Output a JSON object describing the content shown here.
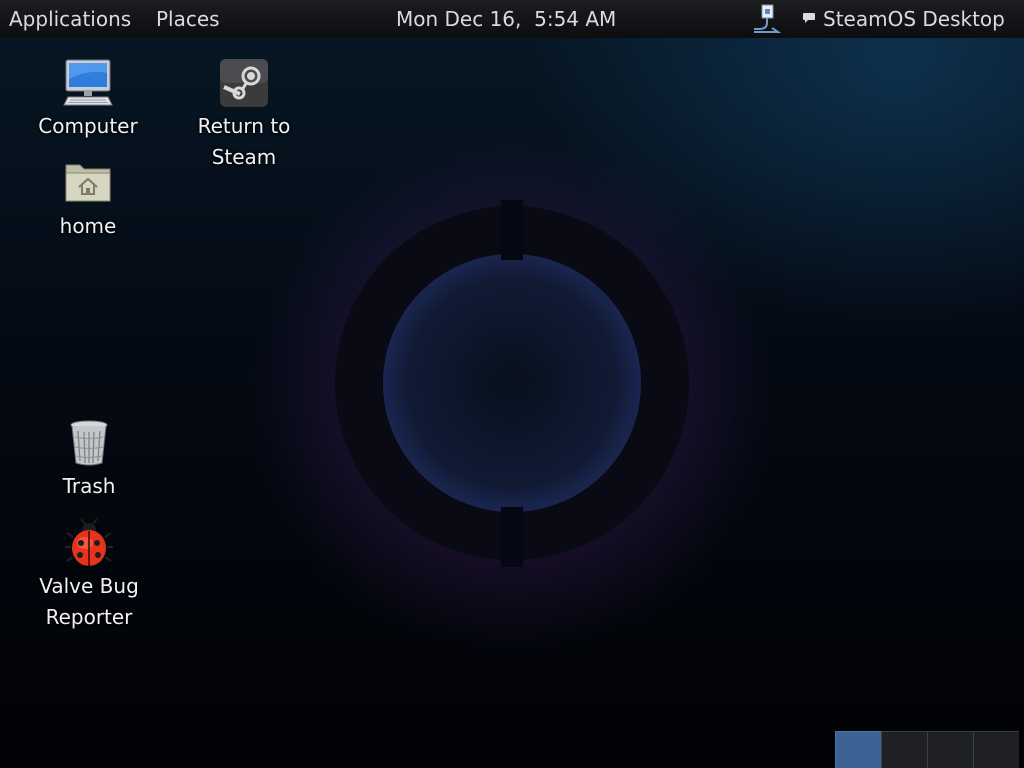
{
  "top_panel": {
    "applications_label": "Applications",
    "places_label": "Places",
    "clock": {
      "date": "Mon Dec 16,",
      "time": "5:54 AM"
    },
    "session_label": "SteamOS Desktop"
  },
  "desktop": {
    "items": [
      {
        "label": "Computer",
        "icon": "computer-icon"
      },
      {
        "label_line1": "Return to",
        "label_line2": "Steam",
        "icon": "steam-icon"
      },
      {
        "label": "home",
        "icon": "home-folder-icon"
      },
      {
        "label": "Trash",
        "icon": "trash-icon"
      },
      {
        "label_line1": "Valve Bug",
        "label_line2": "Reporter",
        "icon": "ladybug-icon"
      }
    ]
  },
  "workspace_switcher": {
    "count": 4,
    "active_index": 0,
    "colors": {
      "active": "#3c6394",
      "inactive": "#1e2023"
    }
  },
  "colors": {
    "panel": "#0c0d0f",
    "panel_text": "#d9dbdc",
    "desktop_text": "#f2f2f2"
  }
}
